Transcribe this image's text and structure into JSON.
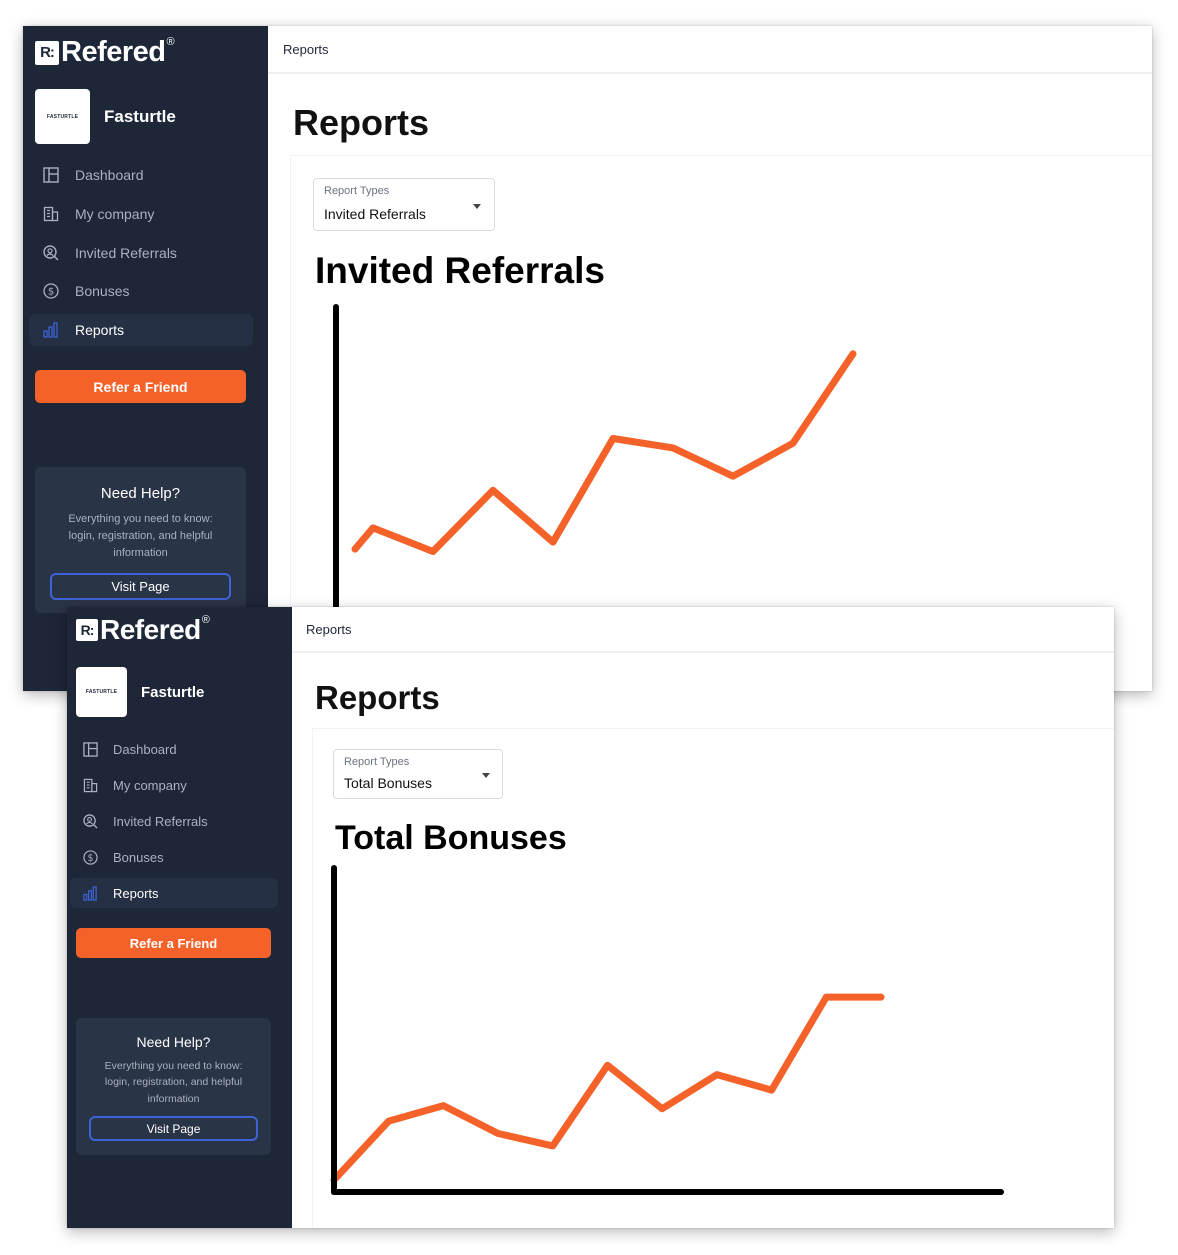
{
  "brand": {
    "mark": "R:",
    "name": "Refered",
    "registered": "®"
  },
  "company": {
    "logo_text": "FASTURTLE",
    "name": "Fasturtle"
  },
  "nav": [
    {
      "label": "Dashboard",
      "icon": "dashboard-icon"
    },
    {
      "label": "My company",
      "icon": "building-icon"
    },
    {
      "label": "Invited Referrals",
      "icon": "user-search-icon"
    },
    {
      "label": "Bonuses",
      "icon": "dollar-circle-icon"
    },
    {
      "label": "Reports",
      "icon": "bar-chart-icon",
      "active": true
    }
  ],
  "refer_button": "Refer a Friend",
  "help": {
    "title": "Need Help?",
    "text": "Everything you need to know: login, registration, and helpful information",
    "button": "Visit Page"
  },
  "colors": {
    "sidebar": "#1e2738",
    "accent": "#f4622a",
    "active_icon": "#3d63d6"
  },
  "screens": [
    {
      "breadcrumb": "Reports",
      "page_title": "Reports",
      "select": {
        "label": "Report Types",
        "value": "Invited Referrals"
      }
    },
    {
      "breadcrumb": "Reports",
      "page_title": "Reports",
      "select": {
        "label": "Report Types",
        "value": "Total Bonuses"
      }
    }
  ],
  "chart_data": [
    {
      "type": "line",
      "title": "Invited Referrals",
      "xlabel": "",
      "ylabel": "",
      "x": [
        0,
        1,
        2,
        3,
        4,
        5,
        6,
        7,
        8,
        9
      ],
      "series": [
        {
          "values": [
            0.7,
            2.2,
            1.7,
            3.0,
            1.9,
            4.1,
            3.9,
            3.3,
            4.0,
            5.9
          ]
        }
      ],
      "ylim": [
        -0.5,
        8
      ],
      "x_visible_until": 0.7,
      "line_color": "#f4622a",
      "grid": false
    },
    {
      "type": "line",
      "title": "Total Bonuses",
      "xlabel": "",
      "ylabel": "",
      "x": [
        0,
        1,
        2,
        3,
        4,
        5,
        6,
        7,
        8,
        9,
        10
      ],
      "series": [
        {
          "values": [
            0,
            1.9,
            2.4,
            1.5,
            1.1,
            3.7,
            2.3,
            3.4,
            2.9,
            5.9,
            5.9
          ]
        }
      ],
      "ylim": [
        0,
        10
      ],
      "line_color": "#f4622a",
      "grid": false
    }
  ]
}
